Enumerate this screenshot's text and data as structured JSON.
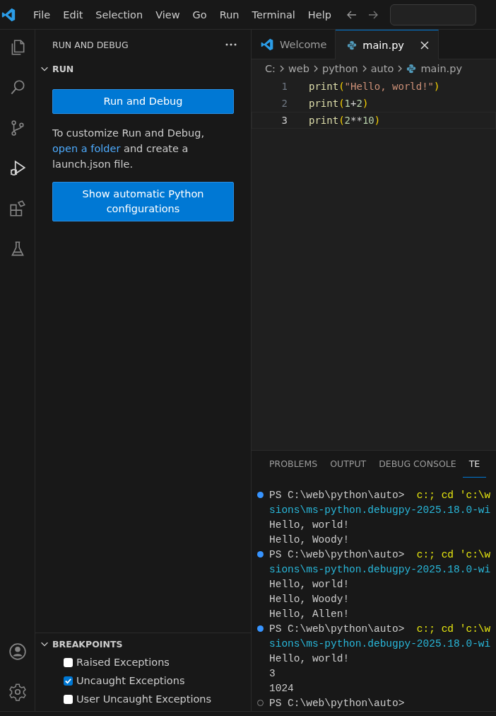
{
  "menu": [
    "File",
    "Edit",
    "Selection",
    "View",
    "Go",
    "Run",
    "Terminal",
    "Help"
  ],
  "activity_bar": {
    "top": [
      {
        "kind": "files",
        "selected": false
      },
      {
        "kind": "search",
        "selected": false
      },
      {
        "kind": "source-control",
        "selected": false
      },
      {
        "kind": "run-debug",
        "selected": true
      },
      {
        "kind": "extensions",
        "selected": false
      },
      {
        "kind": "testing",
        "selected": false
      }
    ],
    "bottom": [
      {
        "kind": "account"
      },
      {
        "kind": "settings"
      }
    ]
  },
  "sidebar": {
    "title": "RUN AND DEBUG",
    "run_section": {
      "title": "RUN",
      "expanded": true,
      "primary_button": "Run and Debug",
      "hint": {
        "before": "To customize Run and Debug,",
        "link": "open a folder",
        "after": "and create a launch.json file."
      },
      "secondary_button": "Show automatic Python configurations"
    },
    "breakpoints": {
      "title": "BREAKPOINTS",
      "expanded": true,
      "items": [
        {
          "label": "Raised Exceptions",
          "checked": false
        },
        {
          "label": "Uncaught Exceptions",
          "checked": true
        },
        {
          "label": "User Uncaught Exceptions",
          "checked": false
        }
      ]
    }
  },
  "editor": {
    "tabs": [
      {
        "label": "Welcome",
        "kind": "welcome",
        "selected": false
      },
      {
        "label": "main.py",
        "kind": "python",
        "selected": true
      }
    ],
    "breadcrumbs": [
      {
        "label": "C:",
        "kind": "folder"
      },
      {
        "label": "web",
        "kind": "folder"
      },
      {
        "label": "python",
        "kind": "folder"
      },
      {
        "label": "auto",
        "kind": "folder"
      },
      {
        "label": "main.py",
        "kind": "python"
      }
    ],
    "lines": [
      {
        "number": "1",
        "current": false,
        "tokens": [
          {
            "kind": "function",
            "text": "print"
          },
          {
            "kind": "paren",
            "text": "("
          },
          {
            "kind": "string",
            "text": "\"Hello, world!\""
          },
          {
            "kind": "paren",
            "text": ")"
          }
        ]
      },
      {
        "number": "2",
        "current": false,
        "tokens": [
          {
            "kind": "function",
            "text": "print"
          },
          {
            "kind": "paren",
            "text": "("
          },
          {
            "kind": "number",
            "text": "1"
          },
          {
            "kind": "operator",
            "text": "+"
          },
          {
            "kind": "number",
            "text": "2"
          },
          {
            "kind": "paren",
            "text": ")"
          }
        ]
      },
      {
        "number": "3",
        "current": true,
        "tokens": [
          {
            "kind": "function",
            "text": "print"
          },
          {
            "kind": "paren",
            "text": "("
          },
          {
            "kind": "number",
            "text": "2"
          },
          {
            "kind": "operator",
            "text": "**"
          },
          {
            "kind": "number",
            "text": "10"
          },
          {
            "kind": "paren",
            "text": ")"
          }
        ]
      }
    ]
  },
  "panel": {
    "tabs": [
      {
        "label": "PROBLEMS",
        "selected": false
      },
      {
        "label": "OUTPUT",
        "selected": false
      },
      {
        "label": "DEBUG CONSOLE",
        "selected": false
      },
      {
        "label": "TE",
        "selected": true
      }
    ],
    "terminal": [
      {
        "kind": "prompt",
        "succeeded": true,
        "prompt": "PS C:\\web\\python\\auto>",
        "command": "c:; cd 'c:\\w"
      },
      {
        "kind": "wrap",
        "text": "sions\\ms-python.debugpy-2025.18.0-wi"
      },
      {
        "kind": "output",
        "text": "Hello, world!"
      },
      {
        "kind": "output",
        "text": "Hello, Woody!"
      },
      {
        "kind": "prompt",
        "succeeded": true,
        "prompt": "PS C:\\web\\python\\auto>",
        "command": "c:; cd 'c:\\w"
      },
      {
        "kind": "wrap",
        "text": "sions\\ms-python.debugpy-2025.18.0-wi"
      },
      {
        "kind": "output",
        "text": "Hello, world!"
      },
      {
        "kind": "output",
        "text": "Hello, Woody!"
      },
      {
        "kind": "output",
        "text": "Hello, Allen!"
      },
      {
        "kind": "prompt",
        "succeeded": true,
        "prompt": "PS C:\\web\\python\\auto>",
        "command": "c:; cd 'c:\\w"
      },
      {
        "kind": "wrap",
        "text": "sions\\ms-python.debugpy-2025.18.0-wi"
      },
      {
        "kind": "output",
        "text": "Hello, world!"
      },
      {
        "kind": "output",
        "text": "3"
      },
      {
        "kind": "output",
        "text": "1024"
      },
      {
        "kind": "prompt",
        "succeeded": false,
        "prompt": "PS C:\\web\\python\\auto>"
      }
    ]
  }
}
